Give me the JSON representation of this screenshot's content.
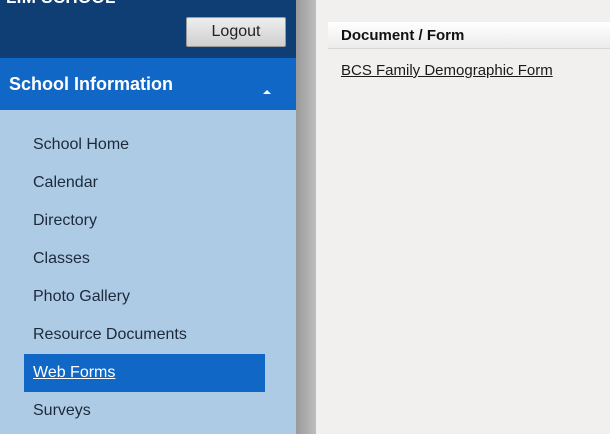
{
  "header": {
    "cut_title": "LIM SCHOOL",
    "logout_label": "Logout"
  },
  "sidebar": {
    "section_title": "School Information",
    "items": [
      {
        "label": "School Home",
        "active": false
      },
      {
        "label": "Calendar",
        "active": false
      },
      {
        "label": "Directory",
        "active": false
      },
      {
        "label": "Classes",
        "active": false
      },
      {
        "label": "Photo Gallery",
        "active": false
      },
      {
        "label": "Resource Documents",
        "active": false
      },
      {
        "label": "Web Forms",
        "active": true
      },
      {
        "label": "Surveys",
        "active": false
      }
    ]
  },
  "main": {
    "table_header": "Document / Form",
    "rows": [
      {
        "label": "BCS Family Demographic Form"
      }
    ]
  },
  "colors": {
    "top_bar": "#0f3e75",
    "accent_blue": "#1067c5",
    "sidebar_bg": "#aecbe6",
    "content_bg": "#f1f0ee"
  }
}
